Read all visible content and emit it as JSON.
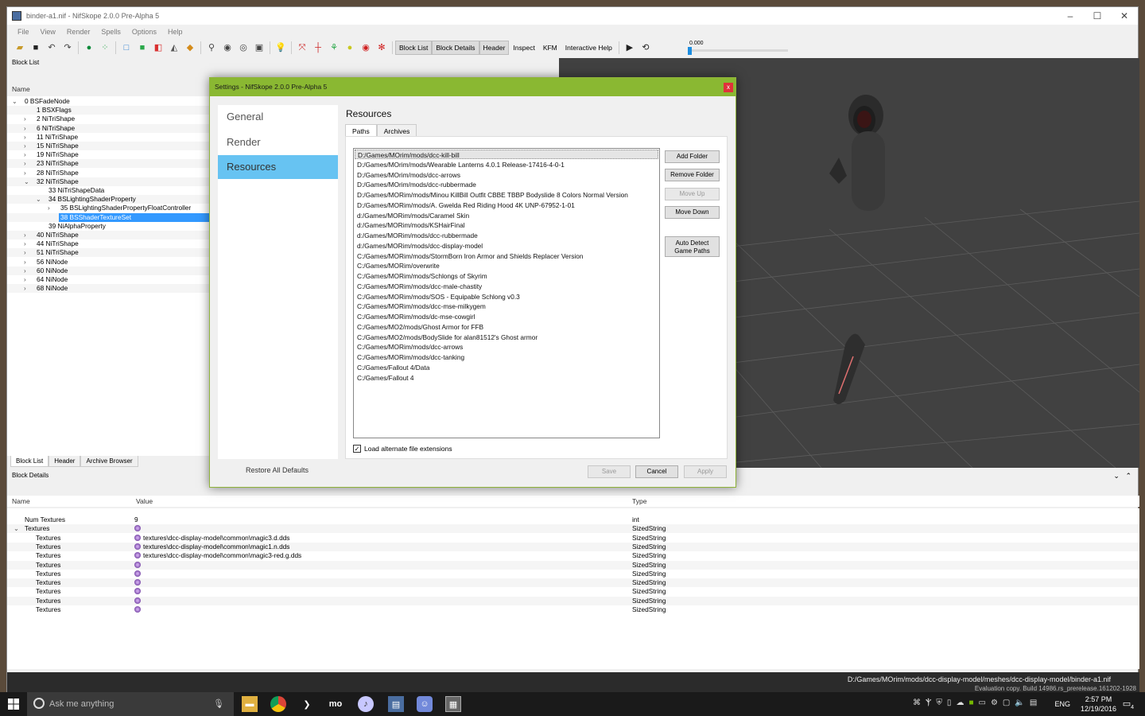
{
  "window": {
    "title": "binder-a1.nif - NifSkope 2.0.0 Pre-Alpha 5",
    "minimize": "–",
    "maximize": "☐",
    "close": "✕"
  },
  "menu": [
    "File",
    "View",
    "Render",
    "Spells",
    "Options",
    "Help"
  ],
  "toolbar": {
    "tabs": [
      "Block List",
      "Block Details",
      "Header",
      "Inspect",
      "KFM",
      "Interactive Help"
    ],
    "slider_value": "0.000"
  },
  "block_list": {
    "title": "Block List",
    "column": "Name",
    "rows": [
      {
        "label": "0 BSFadeNode",
        "arrow": "down"
      },
      {
        "label": "1 BSXFlags",
        "arrow": ""
      },
      {
        "label": "2 NiTriShape",
        "arrow": "right"
      },
      {
        "label": "6 NiTriShape",
        "arrow": "right"
      },
      {
        "label": "11 NiTriShape",
        "arrow": "right"
      },
      {
        "label": "15 NiTriShape",
        "arrow": "right"
      },
      {
        "label": "19 NiTriShape",
        "arrow": "right"
      },
      {
        "label": "23 NiTriShape",
        "arrow": "right"
      },
      {
        "label": "28 NiTriShape",
        "arrow": "right"
      },
      {
        "label": "32 NiTriShape",
        "arrow": "down"
      },
      {
        "label": "33 NiTriShapeData",
        "arrow": ""
      },
      {
        "label": "34 BSLightingShaderProperty",
        "arrow": "down"
      },
      {
        "label": "35 BSLightingShaderPropertyFloatController",
        "arrow": "right"
      },
      {
        "label": "38 BSShaderTextureSet",
        "arrow": "",
        "selected": true
      },
      {
        "label": "39 NiAlphaProperty",
        "arrow": ""
      },
      {
        "label": "40 NiTriShape",
        "arrow": "right"
      },
      {
        "label": "44 NiTriShape",
        "arrow": "right"
      },
      {
        "label": "51 NiTriShape",
        "arrow": "right"
      },
      {
        "label": "56 NiNode",
        "arrow": "right"
      },
      {
        "label": "60 NiNode",
        "arrow": "right"
      },
      {
        "label": "64 NiNode",
        "arrow": "right"
      },
      {
        "label": "68 NiNode",
        "arrow": "right"
      }
    ],
    "tabs": [
      "Block List",
      "Header",
      "Archive Browser"
    ]
  },
  "block_details": {
    "title": "Block Details",
    "columns": {
      "name": "Name",
      "value": "Value",
      "type": "Type"
    },
    "rows": [
      {
        "name": "Num Textures",
        "value": "9",
        "type": "int",
        "icon": false,
        "arrow": ""
      },
      {
        "name": "Textures",
        "value": "",
        "type": "SizedString",
        "icon": true,
        "arrow": "down"
      },
      {
        "name": "Textures",
        "value": "textures\\dcc-display-model\\common\\magic3.d.dds",
        "type": "SizedString",
        "icon": true,
        "arrow": ""
      },
      {
        "name": "Textures",
        "value": "textures\\dcc-display-model\\common\\magic1.n.dds",
        "type": "SizedString",
        "icon": true,
        "arrow": ""
      },
      {
        "name": "Textures",
        "value": "textures\\dcc-display-model\\common\\magic3-red.g.dds",
        "type": "SizedString",
        "icon": true,
        "arrow": ""
      },
      {
        "name": "Textures",
        "value": "",
        "type": "SizedString",
        "icon": true,
        "arrow": ""
      },
      {
        "name": "Textures",
        "value": "",
        "type": "SizedString",
        "icon": true,
        "arrow": ""
      },
      {
        "name": "Textures",
        "value": "",
        "type": "SizedString",
        "icon": true,
        "arrow": ""
      },
      {
        "name": "Textures",
        "value": "",
        "type": "SizedString",
        "icon": true,
        "arrow": ""
      },
      {
        "name": "Textures",
        "value": "",
        "type": "SizedString",
        "icon": true,
        "arrow": ""
      },
      {
        "name": "Textures",
        "value": "",
        "type": "SizedString",
        "icon": true,
        "arrow": ""
      }
    ]
  },
  "status": {
    "path": "D:/Games/MOrim/mods/dcc-display-model/meshes/dcc-display-model/binder-a1.nif",
    "eval": "Evaluation copy. Build 14986.rs_prerelease.161202-1928"
  },
  "dialog": {
    "title": "Settings - NifSkope 2.0.0 Pre-Alpha 5",
    "close": "x",
    "nav": [
      "General",
      "Render",
      "Resources"
    ],
    "active_nav": "Resources",
    "heading": "Resources",
    "tabs": [
      "Paths",
      "Archives"
    ],
    "paths": [
      "D:/Games/MOrim/mods/dcc-kill-bill",
      "D:/Games/MOrim/mods/Wearable Lanterns 4.0.1 Release-17416-4-0-1",
      "D:/Games/MOrim/mods/dcc-arrows",
      "D:/Games/MOrim/mods/dcc-rubbermade",
      "D:/Games/MORim/mods/Minou KillBill Outfit CBBE TBBP Bodyslide 8 Colors Normal Version",
      "D:/Games/MORim/mods/A. Gwelda Red Riding Hood 4K UNP-67952-1-01",
      "d:/Games/MORim/mods/Caramel Skin",
      "d:/Games/MORim/mods/KSHairFinal",
      "d:/Games/MORim/mods/dcc-rubbermade",
      "d:/Games/MORim/mods/dcc-display-model",
      "C:/Games/MORim/mods/StormBorn Iron Armor and Shields Replacer Version",
      "C:/Games/MORim/overwrite",
      "C:/Games/MORim/mods/Schlongs of Skyrim",
      "C:/Games/MORim/mods/dcc-male-chastity",
      "C:/Games/MORim/mods/SOS - Equipable Schlong v0.3",
      "C:/Games/MORim/mods/dcc-mse-milkygem",
      "C:/Games/MORim/mods/dc-mse-cowgirl",
      "C:/Games/MO2/mods/Ghost Armor for FFB",
      "C:/Games/MO2/mods/BodySlide for alan81512's Ghost armor",
      "C:/Games/MORim/mods/dcc-arrows",
      "C:/Games/MORim/mods/dcc-tanking",
      "C:/Games/Fallout 4/Data",
      "C:/Games/Fallout 4"
    ],
    "buttons": {
      "add_folder": "Add Folder",
      "remove_folder": "Remove Folder",
      "move_up": "Move Up",
      "move_down": "Move Down",
      "auto_detect_1": "Auto Detect",
      "auto_detect_2": "Game Paths"
    },
    "checkbox": {
      "label": "Load alternate file extensions",
      "checked": true
    },
    "restore": "Restore All Defaults",
    "save": "Save",
    "cancel": "Cancel",
    "apply": "Apply"
  },
  "taskbar": {
    "search_placeholder": "Ask me anything",
    "language": "ENG",
    "time": "2:57 PM",
    "date": "12/19/2016",
    "notifications": "4"
  },
  "colors": {
    "dialog_title": "#8ab832",
    "nav_active": "#67c3f2",
    "selection": "#3399ff",
    "viewport": "#414141"
  }
}
